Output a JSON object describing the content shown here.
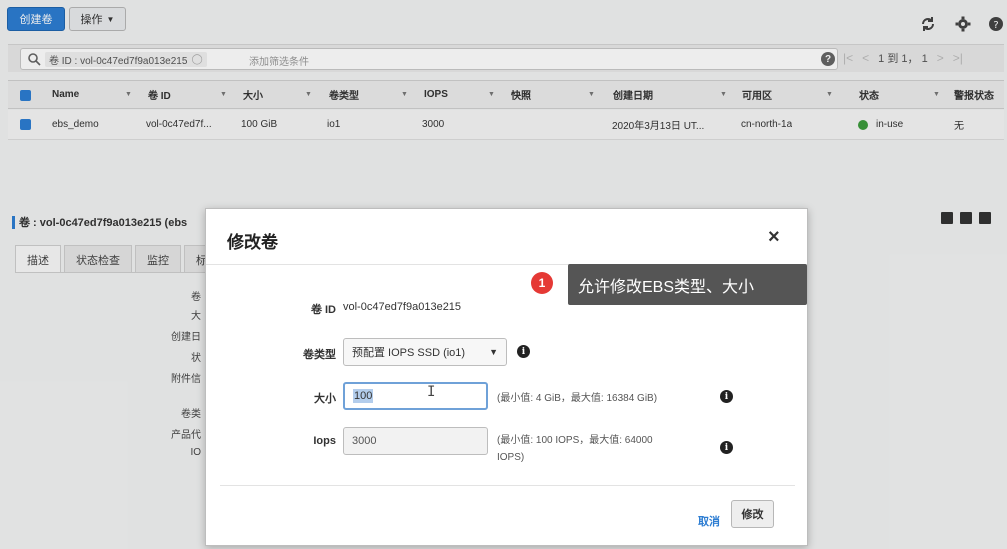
{
  "toolbar": {
    "create_label": "创建卷",
    "actions_label": "操作",
    "refresh_icon": "refresh-icon",
    "settings_icon": "gear-icon",
    "help_icon": "help-icon"
  },
  "filter": {
    "chip_text": "卷 ID : vol-0c47ed7f9a013e215",
    "placeholder": "添加筛选条件",
    "help": "?"
  },
  "pager": {
    "first": "|<",
    "prev": "<",
    "range": "1 到 1，",
    "count": "1",
    "next": ">",
    "last": ">|"
  },
  "grid": {
    "columns": [
      "Name",
      "卷 ID",
      "大小",
      "卷类型",
      "IOPS",
      "快照",
      "创建日期",
      "可用区",
      "状态",
      "警报状态"
    ],
    "rows": [
      {
        "name": "ebs_demo",
        "volume_id": "vol-0c47ed7f...",
        "size": "100 GiB",
        "type": "io1",
        "iops": "3000",
        "snapshot": "",
        "created": "2020年3月13日 UT...",
        "zone": "cn-north-1a",
        "status": "in-use",
        "alarm": "无"
      }
    ]
  },
  "detail": {
    "title": "卷 : vol-0c47ed7f9a013e215 (ebs",
    "tabs": [
      "描述",
      "状态检查",
      "监控",
      "标"
    ],
    "labels": [
      "卷",
      "大",
      "创建日",
      "状",
      "附件信",
      "卷类",
      "产品代",
      "IO"
    ]
  },
  "modal": {
    "title": "修改卷",
    "close": "×",
    "volume_id_label": "卷 ID",
    "volume_id_value": "vol-0c47ed7f9a013e215",
    "type_label": "卷类型",
    "type_value": "预配置 IOPS SSD (io1)",
    "size_label": "大小",
    "size_value": "100",
    "size_hint": "(最小值: 4 GiB，最大值: 16384 GiB)",
    "iops_label": "Iops",
    "iops_value": "3000",
    "iops_hint_line1": "(最小值: 100 IOPS，最大值: 64000",
    "iops_hint_line2": "IOPS)",
    "cancel_label": "取消",
    "modify_label": "修改"
  },
  "annotation": {
    "number": "1",
    "text": "允许修改EBS类型、大小",
    "badge_color": "#e53935"
  }
}
